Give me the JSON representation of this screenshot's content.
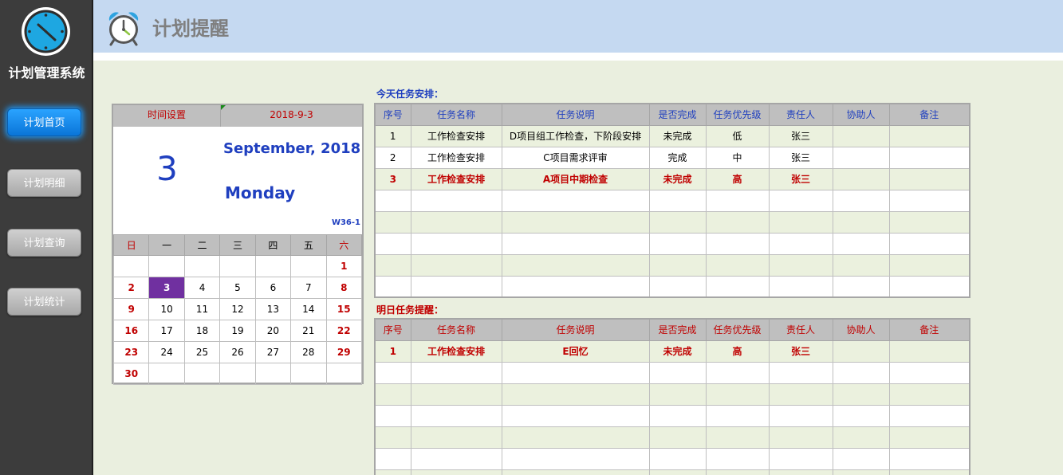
{
  "sidebar": {
    "app_title": "计划管理系统",
    "nav": [
      {
        "label": "计划首页",
        "active": true
      },
      {
        "label": "计划明细",
        "active": false
      },
      {
        "label": "计划查询",
        "active": false
      },
      {
        "label": "计划统计",
        "active": false
      }
    ]
  },
  "header": {
    "title": "计划提醒"
  },
  "calendar": {
    "time_setting_label": "时间设置",
    "date_value": "2018-9-3",
    "big_day": "3",
    "month_year": "September, 2018",
    "weekday": "Monday",
    "week_code": "W36-1",
    "weekday_headers": [
      "日",
      "一",
      "二",
      "三",
      "四",
      "五",
      "六"
    ],
    "weeks": [
      [
        "",
        "",
        "",
        "",
        "",
        "",
        "1"
      ],
      [
        "2",
        "3",
        "4",
        "5",
        "6",
        "7",
        "8"
      ],
      [
        "9",
        "10",
        "11",
        "12",
        "13",
        "14",
        "15"
      ],
      [
        "16",
        "17",
        "18",
        "19",
        "20",
        "21",
        "22"
      ],
      [
        "23",
        "24",
        "25",
        "26",
        "27",
        "28",
        "29"
      ],
      [
        "30",
        "",
        "",
        "",
        "",
        "",
        ""
      ]
    ],
    "today": "3"
  },
  "today_tasks": {
    "label": "今天任务安排：",
    "columns": [
      "序号",
      "任务名称",
      "任务说明",
      "是否完成",
      "任务优先级",
      "责任人",
      "协助人",
      "备注"
    ],
    "rows": [
      [
        "1",
        "工作检查安排",
        "D项目组工作检查，下阶段安排",
        "未完成",
        "低",
        "张三",
        "",
        ""
      ],
      [
        "2",
        "工作检查安排",
        "C项目需求评审",
        "完成",
        "中",
        "张三",
        "",
        ""
      ],
      [
        "3",
        "工作检查安排",
        "A项目中期检查",
        "未完成",
        "高",
        "张三",
        "",
        ""
      ],
      [
        "",
        "",
        "",
        "",
        "",
        "",
        "",
        ""
      ],
      [
        "",
        "",
        "",
        "",
        "",
        "",
        "",
        ""
      ],
      [
        "",
        "",
        "",
        "",
        "",
        "",
        "",
        ""
      ],
      [
        "",
        "",
        "",
        "",
        "",
        "",
        "",
        ""
      ],
      [
        "",
        "",
        "",
        "",
        "",
        "",
        "",
        ""
      ]
    ],
    "highlight_rows": [
      2
    ]
  },
  "tomorrow_tasks": {
    "label": "明日任务提醒：",
    "columns": [
      "序号",
      "任务名称",
      "任务说明",
      "是否完成",
      "任务优先级",
      "责任人",
      "协助人",
      "备注"
    ],
    "rows": [
      [
        "1",
        "工作检查安排",
        "E回忆",
        "未完成",
        "高",
        "张三",
        "",
        ""
      ],
      [
        "",
        "",
        "",
        "",
        "",
        "",
        "",
        ""
      ],
      [
        "",
        "",
        "",
        "",
        "",
        "",
        "",
        ""
      ],
      [
        "",
        "",
        "",
        "",
        "",
        "",
        "",
        ""
      ],
      [
        "",
        "",
        "",
        "",
        "",
        "",
        "",
        ""
      ],
      [
        "",
        "",
        "",
        "",
        "",
        "",
        "",
        ""
      ],
      [
        "",
        "",
        "",
        "",
        "",
        "",
        "",
        ""
      ]
    ],
    "highlight_rows": [
      0
    ]
  },
  "colors": {
    "accent_blue": "#1f3fbf",
    "alert_red": "#c00000",
    "today_cell": "#7030a0",
    "row_alt": "#ebf1de"
  }
}
